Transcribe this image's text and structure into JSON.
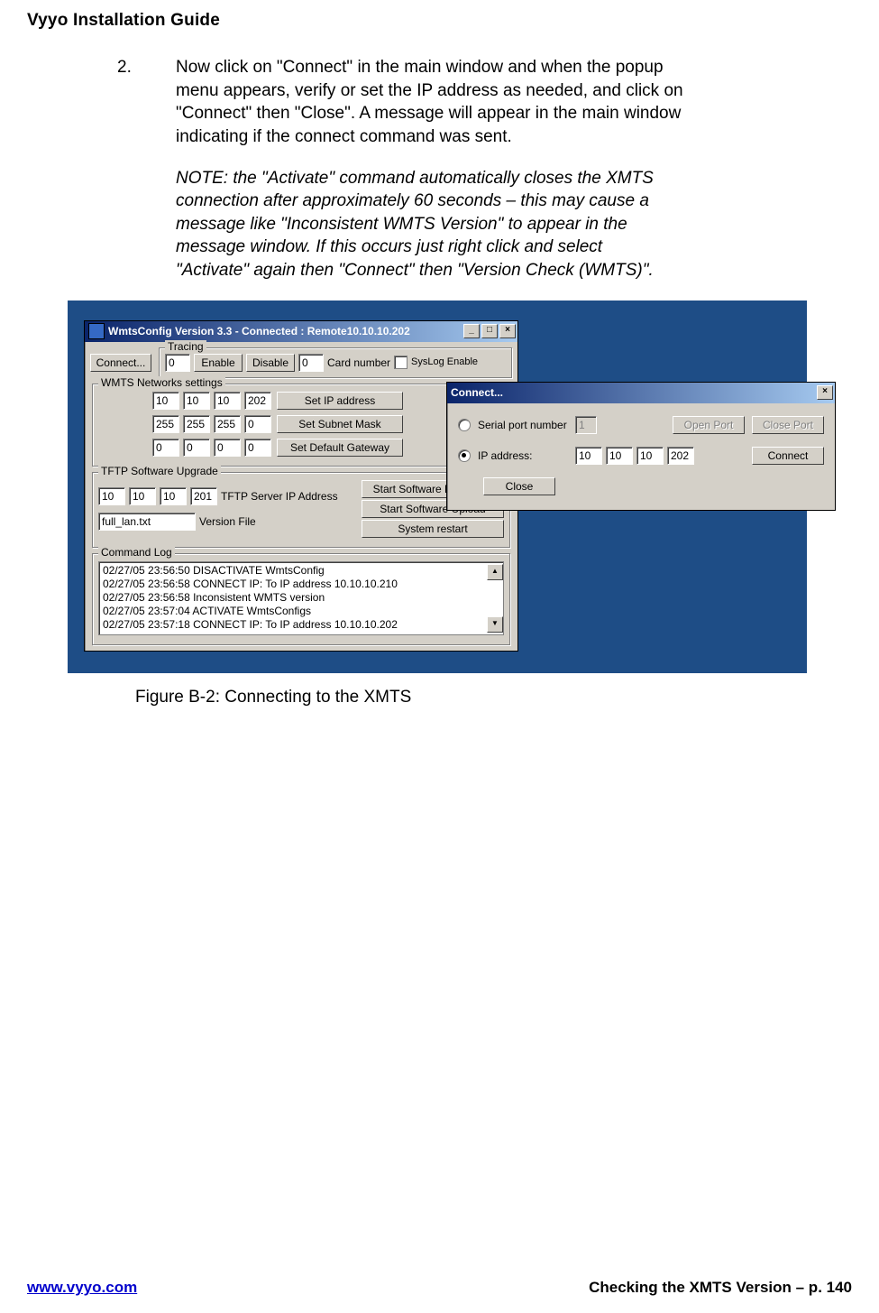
{
  "header": {
    "title": "Vyyo Installation Guide"
  },
  "step": {
    "num": "2.",
    "text": "Now click on \"Connect\" in the main window and when the popup menu appears, verify or set the IP address as needed,  and click on \"Connect\" then \"Close\".  A message will appear in the main window indicating if the connect command was sent."
  },
  "note": "NOTE: the \"Activate\" command automatically closes the XMTS connection after approximately 60 seconds – this may cause a message like \"Inconsistent WMTS Version\" to appear in the message window.  If this occurs just right click and select \"Activate\" again then \"Connect\" then \"Version Check (WMTS)\".",
  "main_window": {
    "title": "WmtsConfig Version 3.3 - Connected : Remote10.10.10.202",
    "connect_btn": "Connect...",
    "tracing": {
      "group": "Tracing",
      "val1": "0",
      "enable": "Enable",
      "disable": "Disable",
      "val2": "0",
      "card_label": "Card number",
      "syslog": "SysLog Enable"
    },
    "networks": {
      "group": "WMTS Networks settings",
      "ip": [
        "10",
        "10",
        "10",
        "202"
      ],
      "mask": [
        "255",
        "255",
        "255",
        "0"
      ],
      "gw": [
        "0",
        "0",
        "0",
        "0"
      ],
      "btn_ip": "Set IP address",
      "btn_mask": "Set Subnet Mask",
      "btn_gw": "Set Default Gateway"
    },
    "tftp": {
      "group": "TFTP Software Upgrade",
      "server": [
        "10",
        "10",
        "10",
        "201"
      ],
      "server_label": "TFTP Server IP Address",
      "vfile": "full_lan.txt",
      "vfile_label": "Version File",
      "btn_dl": "Start Software Download",
      "btn_ul": "Start Software Upload",
      "btn_restart": "System restart"
    },
    "log": {
      "group": "Command Log",
      "lines": [
        "02/27/05 23:56:50 DISACTIVATE WmtsConfig",
        "02/27/05 23:56:58 CONNECT IP: To IP address 10.10.10.210",
        "02/27/05 23:56:58 Inconsistent WMTS version",
        "02/27/05 23:57:04 ACTIVATE WmtsConfigs",
        "02/27/05 23:57:18 CONNECT IP: To IP address 10.10.10.202"
      ]
    }
  },
  "connect_dialog": {
    "title": "Connect...",
    "serial_label": "Serial port number",
    "serial_val": "1",
    "open_port": "Open Port",
    "close_port": "Close Port",
    "ip_label": "IP address:",
    "ip": [
      "10",
      "10",
      "10",
      "202"
    ],
    "connect": "Connect",
    "close": "Close"
  },
  "caption": "Figure B-2:  Connecting to the XMTS",
  "footer": {
    "url": "www.vyyo.com",
    "right": "Checking the XMTS Version – p. 140"
  }
}
